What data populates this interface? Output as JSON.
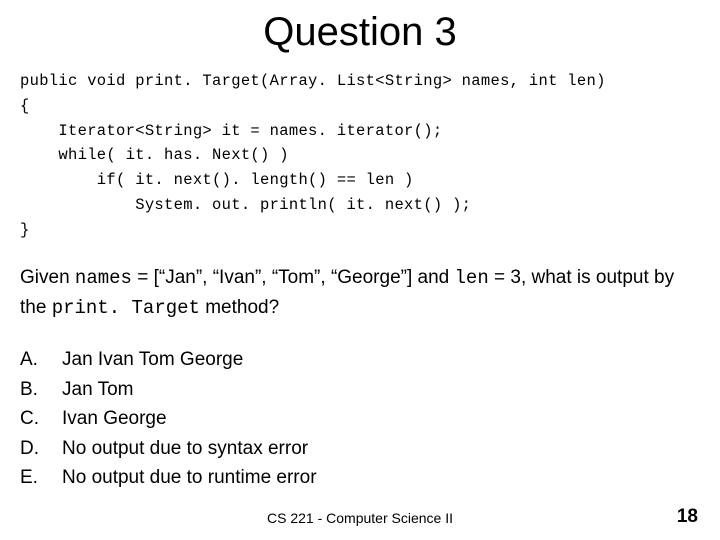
{
  "title": "Question 3",
  "code": "public void print. Target(Array. List<String> names, int len)\n{\n    Iterator<String> it = names. iterator();\n    while( it. has. Next() )\n        if( it. next(). length() == len )\n            System. out. println( it. next() );\n}",
  "question": {
    "prefix": "Given ",
    "names_var": "names",
    "equals1": " = [“Jan”, “Ivan”, “Tom”, “George”]  and ",
    "len_var": "len",
    "equals2": " = 3, what is output by the ",
    "method": "print. Target",
    "suffix": " method?"
  },
  "answers": [
    {
      "letter": "A.",
      "text": "Jan Ivan Tom George"
    },
    {
      "letter": "B.",
      "text": "Jan Tom"
    },
    {
      "letter": "C.",
      "text": "Ivan George"
    },
    {
      "letter": "D.",
      "text": "No output due to syntax error"
    },
    {
      "letter": "E.",
      "text": "No output due to runtime error"
    }
  ],
  "footer": "CS 221 - Computer Science II",
  "page_number": "18"
}
